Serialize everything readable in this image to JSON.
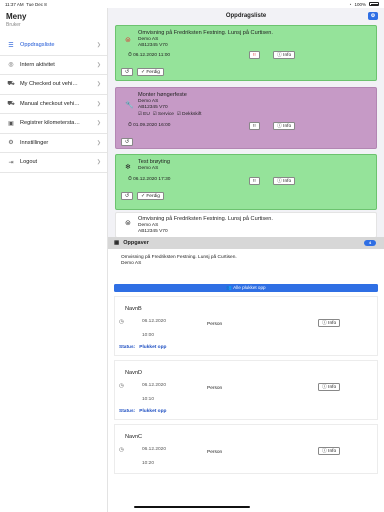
{
  "statusbar": {
    "time": "11:37 AM",
    "date": "Tue Dec 8",
    "battery": "100%"
  },
  "sidebar": {
    "title": "Meny",
    "subtitle": "Bruker",
    "items": [
      {
        "label": "Oppdragsliste",
        "icon": "list-icon",
        "glyph": "☰"
      },
      {
        "label": "Intern aktivitet",
        "icon": "eye-icon",
        "glyph": "◎"
      },
      {
        "label": "My Checked out vehi…",
        "icon": "car-icon",
        "glyph": "🚗"
      },
      {
        "label": "Manual checkout vehi…",
        "icon": "car-icon",
        "glyph": "🚗"
      },
      {
        "label": "Registrer kilometersta…",
        "icon": "odometer-icon",
        "glyph": "▣"
      },
      {
        "label": "Innstillinger",
        "icon": "gear-icon",
        "glyph": "⚙"
      },
      {
        "label": "Logout",
        "icon": "logout-icon",
        "glyph": "⇥"
      }
    ]
  },
  "header": {
    "title": "Oppdragsliste"
  },
  "orders": [
    {
      "title": "Omvisning på Fredriksten Festning. Lunsj på Curtisen.",
      "customer": "Demo AS",
      "vehicle": "AB12345 V70",
      "datetime": "06.12.2020 11:00",
      "ferdig_label": "Ferdig",
      "info_label": "Info"
    },
    {
      "title": "Monter høngerfeste",
      "customer": "Demo AS",
      "vehicle": "AB12345 V70",
      "tags": [
        "EU",
        "Service",
        "Dekkskift"
      ],
      "datetime": "01.09.2020 16:00",
      "info_label": "Info"
    },
    {
      "title": "Test brøyting",
      "customer": "Demo AS",
      "datetime": "06.12.2020 17:30",
      "ferdig_label": "Ferdig",
      "info_label": "Info"
    },
    {
      "title": "Omvisning på Fredriksten Festning. Lunsj på Curtisen.",
      "customer": "Demo AS",
      "vehicle": "AB12345 V70"
    }
  ],
  "oppgaver": {
    "title": "Oppgaver",
    "count": "4",
    "summary_line1": "Omvisning på Fredriksten Festning. Lunsj på Curtisen.",
    "summary_line2": "Demo AS",
    "all_button": "Alle plukket opp",
    "tasks": [
      {
        "name": "NavnB",
        "date": "06.12.2020",
        "time": "10:00",
        "role": "Person",
        "info": "Info",
        "status_label": "Status:",
        "status_value": "Plukket opp"
      },
      {
        "name": "NavnD",
        "date": "06.12.2020",
        "time": "10:10",
        "role": "Person",
        "info": "Info",
        "status_label": "Status:",
        "status_value": "Plukket opp"
      },
      {
        "name": "NavnC",
        "date": "06.12.2020",
        "time": "10:20",
        "role": "Person",
        "info": "Info"
      }
    ]
  }
}
